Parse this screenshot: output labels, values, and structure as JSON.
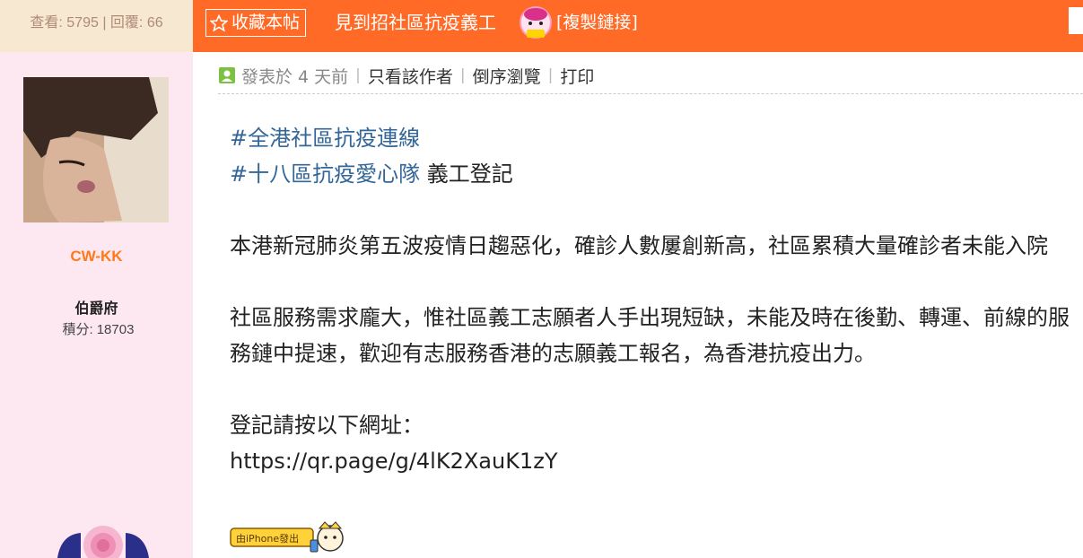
{
  "stats": {
    "views_label": "查看:",
    "views": "5795",
    "separator": "|",
    "replies_label": "回覆:",
    "replies": "66"
  },
  "header": {
    "favorite_label": "收藏本帖",
    "thread_title": "見到招社區抗疫義工",
    "copy_link_label": "[複製鏈接]"
  },
  "user": {
    "username": "CW-KK",
    "rank": "伯爵府",
    "points_label": "積分:",
    "points": "18703"
  },
  "post_meta": {
    "posted": "發表於 4 天前",
    "only_author": "只看該作者",
    "reverse_order": "倒序瀏覽",
    "print": "打印"
  },
  "post": {
    "tag1": "#全港社區抗疫連線",
    "tag2": "#十八區抗疫愛心隊",
    "tag2_suffix": " 義工登記",
    "para1": "本港新冠肺炎第五波疫情日趨惡化，確診人數屢創新高，社區累積大量確診者未能入院",
    "para2": "社區服務需求龐大，惟社區義工志願者人手出現短缺，未能及時在後勤、轉運、前線的服務鏈中提速，歡迎有志服務香港的志願義工報名，為香港抗疫出力。",
    "para3_line1": "登記請按以下網址：",
    "link": "https://qr.page/g/4lK2XauK1zY",
    "badge": "由iPhone發出"
  },
  "colors": {
    "header_orange": "#ff6a26",
    "sidebar_pink": "#fde8f2",
    "stats_bg": "#f7e8d2",
    "username_orange": "#ff7a16",
    "tag_blue": "#336699"
  }
}
